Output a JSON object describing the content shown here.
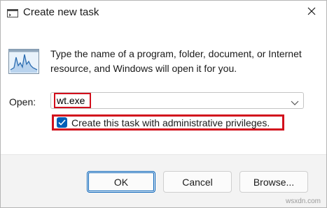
{
  "window": {
    "title": "Create new task",
    "icons": {
      "title": "run-icon",
      "close": "close-icon",
      "app": "program-chart-icon"
    }
  },
  "description": "Type the name of a program, folder, document, or Internet resource, and Windows will open it for you.",
  "open_field": {
    "label": "Open:",
    "value": "wt.exe",
    "dropdown_icon": "chevron-down-icon"
  },
  "admin_checkbox": {
    "label": "Create this task with administrative privileges.",
    "checked": true
  },
  "buttons": {
    "ok": "OK",
    "cancel": "Cancel",
    "browse": "Browse..."
  },
  "watermark": "wsxdn.com",
  "colors": {
    "accent": "#005fb8",
    "highlight_box": "#d20f1c"
  }
}
